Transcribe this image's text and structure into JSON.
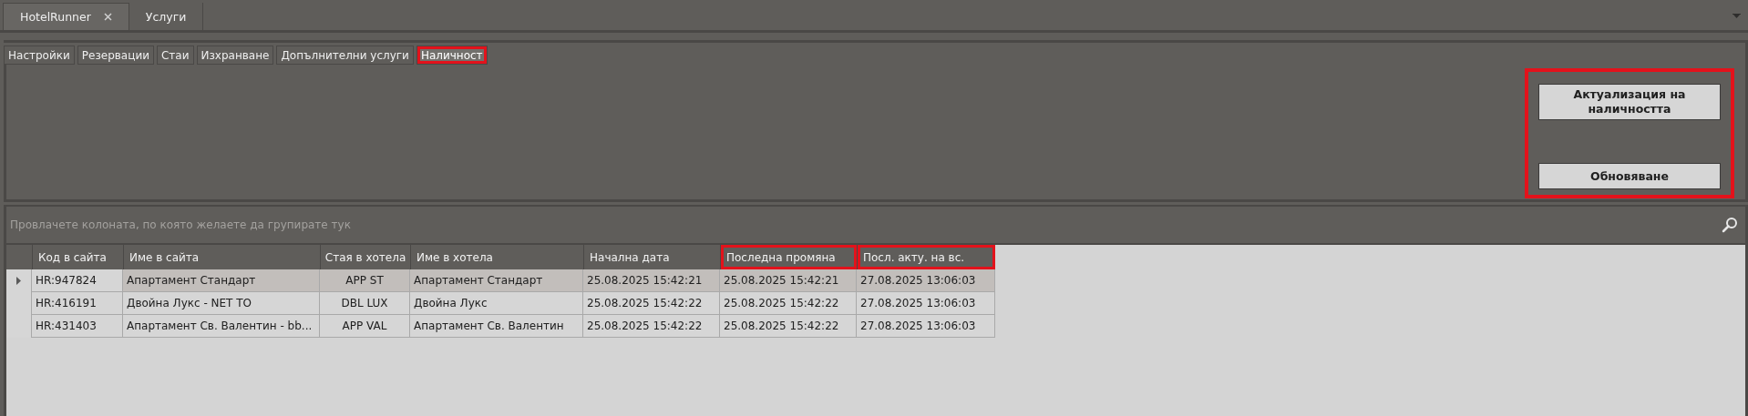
{
  "document_tabs": [
    {
      "label": "HotelRunner",
      "selected": true,
      "closable": true
    },
    {
      "label": "Услуги",
      "selected": false,
      "closable": false
    }
  ],
  "tabs": [
    {
      "label": "Настройки",
      "selected": false,
      "highlighted": false
    },
    {
      "label": "Резервации",
      "selected": false,
      "highlighted": false
    },
    {
      "label": "Стаи",
      "selected": false,
      "highlighted": false
    },
    {
      "label": "Изхранване",
      "selected": false,
      "highlighted": false
    },
    {
      "label": "Допълнителни услуги",
      "selected": false,
      "highlighted": false
    },
    {
      "label": "Наличност",
      "selected": true,
      "highlighted": true
    }
  ],
  "actions": {
    "highlighted": true,
    "buttons": [
      "Актуализация на наличността",
      "Обновяване"
    ]
  },
  "grid": {
    "group_panel_hint": "Провлачете колоната, по която желаете да групирате тук",
    "columns": [
      {
        "label": "Код в сайта",
        "highlighted": false
      },
      {
        "label": "Име в сайта",
        "highlighted": false
      },
      {
        "label": "Стая в хотела",
        "highlighted": false
      },
      {
        "label": "Име в хотела",
        "highlighted": false
      },
      {
        "label": "Начална дата",
        "highlighted": false
      },
      {
        "label": "Последна промяна",
        "highlighted": true
      },
      {
        "label": "Посл. акту. на вс.",
        "highlighted": true
      }
    ],
    "rows": [
      {
        "selected": true,
        "cells": [
          "HR:947824",
          "Апартамент Стандарт",
          "APP ST",
          "Апартамент Стандарт",
          "25.08.2025 15:42:21",
          "25.08.2025 15:42:21",
          "27.08.2025 13:06:03"
        ]
      },
      {
        "selected": false,
        "cells": [
          "HR:416191",
          "Двойна Лукс - NET TO",
          "DBL LUX",
          "Двойна Лукс",
          "25.08.2025 15:42:22",
          "25.08.2025 15:42:22",
          "27.08.2025 13:06:03"
        ]
      },
      {
        "selected": false,
        "cells": [
          "HR:431403",
          "Апартамент Св. Валентин - bb...",
          "APP VAL",
          "Апартамент Св. Валентин",
          "25.08.2025 15:42:22",
          "25.08.2025 15:42:22",
          "27.08.2025 13:06:03"
        ]
      }
    ]
  }
}
